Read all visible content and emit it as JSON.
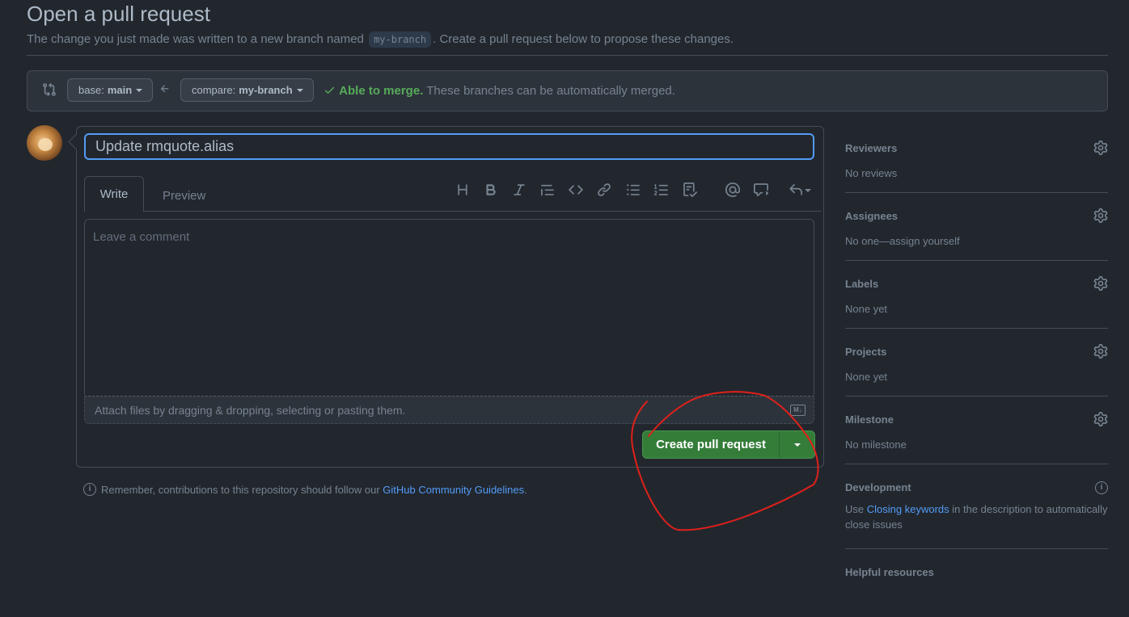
{
  "page": {
    "title": "Open a pull request",
    "subtitle_before": "The change you just made was written to a new branch named",
    "branch_name": "my-branch",
    "subtitle_after": ". Create a pull request below to propose these changes."
  },
  "compare": {
    "base_prefix": "base:",
    "base_branch": "main",
    "compare_prefix": "compare:",
    "compare_branch": "my-branch",
    "merge_ok": "Able to merge.",
    "merge_text": "These branches can be automatically merged."
  },
  "form": {
    "title_value": "Update rmquote.alias",
    "tab_write": "Write",
    "tab_preview": "Preview",
    "comment_placeholder": "Leave a comment",
    "attach_text": "Attach files by dragging & dropping, selecting or pasting them.",
    "markdown_badge": "M↓",
    "submit_label": "Create pull request"
  },
  "toolbar": [
    "heading-icon",
    "bold-icon",
    "italic-icon",
    "quote-icon",
    "code-icon",
    "link-icon",
    "unordered-list-icon",
    "ordered-list-icon",
    "task-list-icon",
    "mention-icon",
    "reference-icon",
    "reply-icon"
  ],
  "guidelines": {
    "text": "Remember, contributions to this repository should follow our",
    "link": "GitHub Community Guidelines",
    "end": "."
  },
  "sidebar": {
    "reviewers": {
      "heading": "Reviewers",
      "value": "No reviews"
    },
    "assignees": {
      "heading": "Assignees",
      "value": "No one—assign yourself"
    },
    "labels": {
      "heading": "Labels",
      "value": "None yet"
    },
    "projects": {
      "heading": "Projects",
      "value": "None yet"
    },
    "milestone": {
      "heading": "Milestone",
      "value": "No milestone"
    },
    "development": {
      "heading": "Development",
      "before": "Use",
      "link": "Closing keywords",
      "after": "in the description to automatically close issues"
    },
    "helpful": {
      "heading": "Helpful resources"
    }
  },
  "colors": {
    "background": "#22272e",
    "accent_blue": "#539bf5",
    "success_green": "#57ab5a",
    "button_green": "#347d39",
    "annotation_red": "#e0201a"
  }
}
